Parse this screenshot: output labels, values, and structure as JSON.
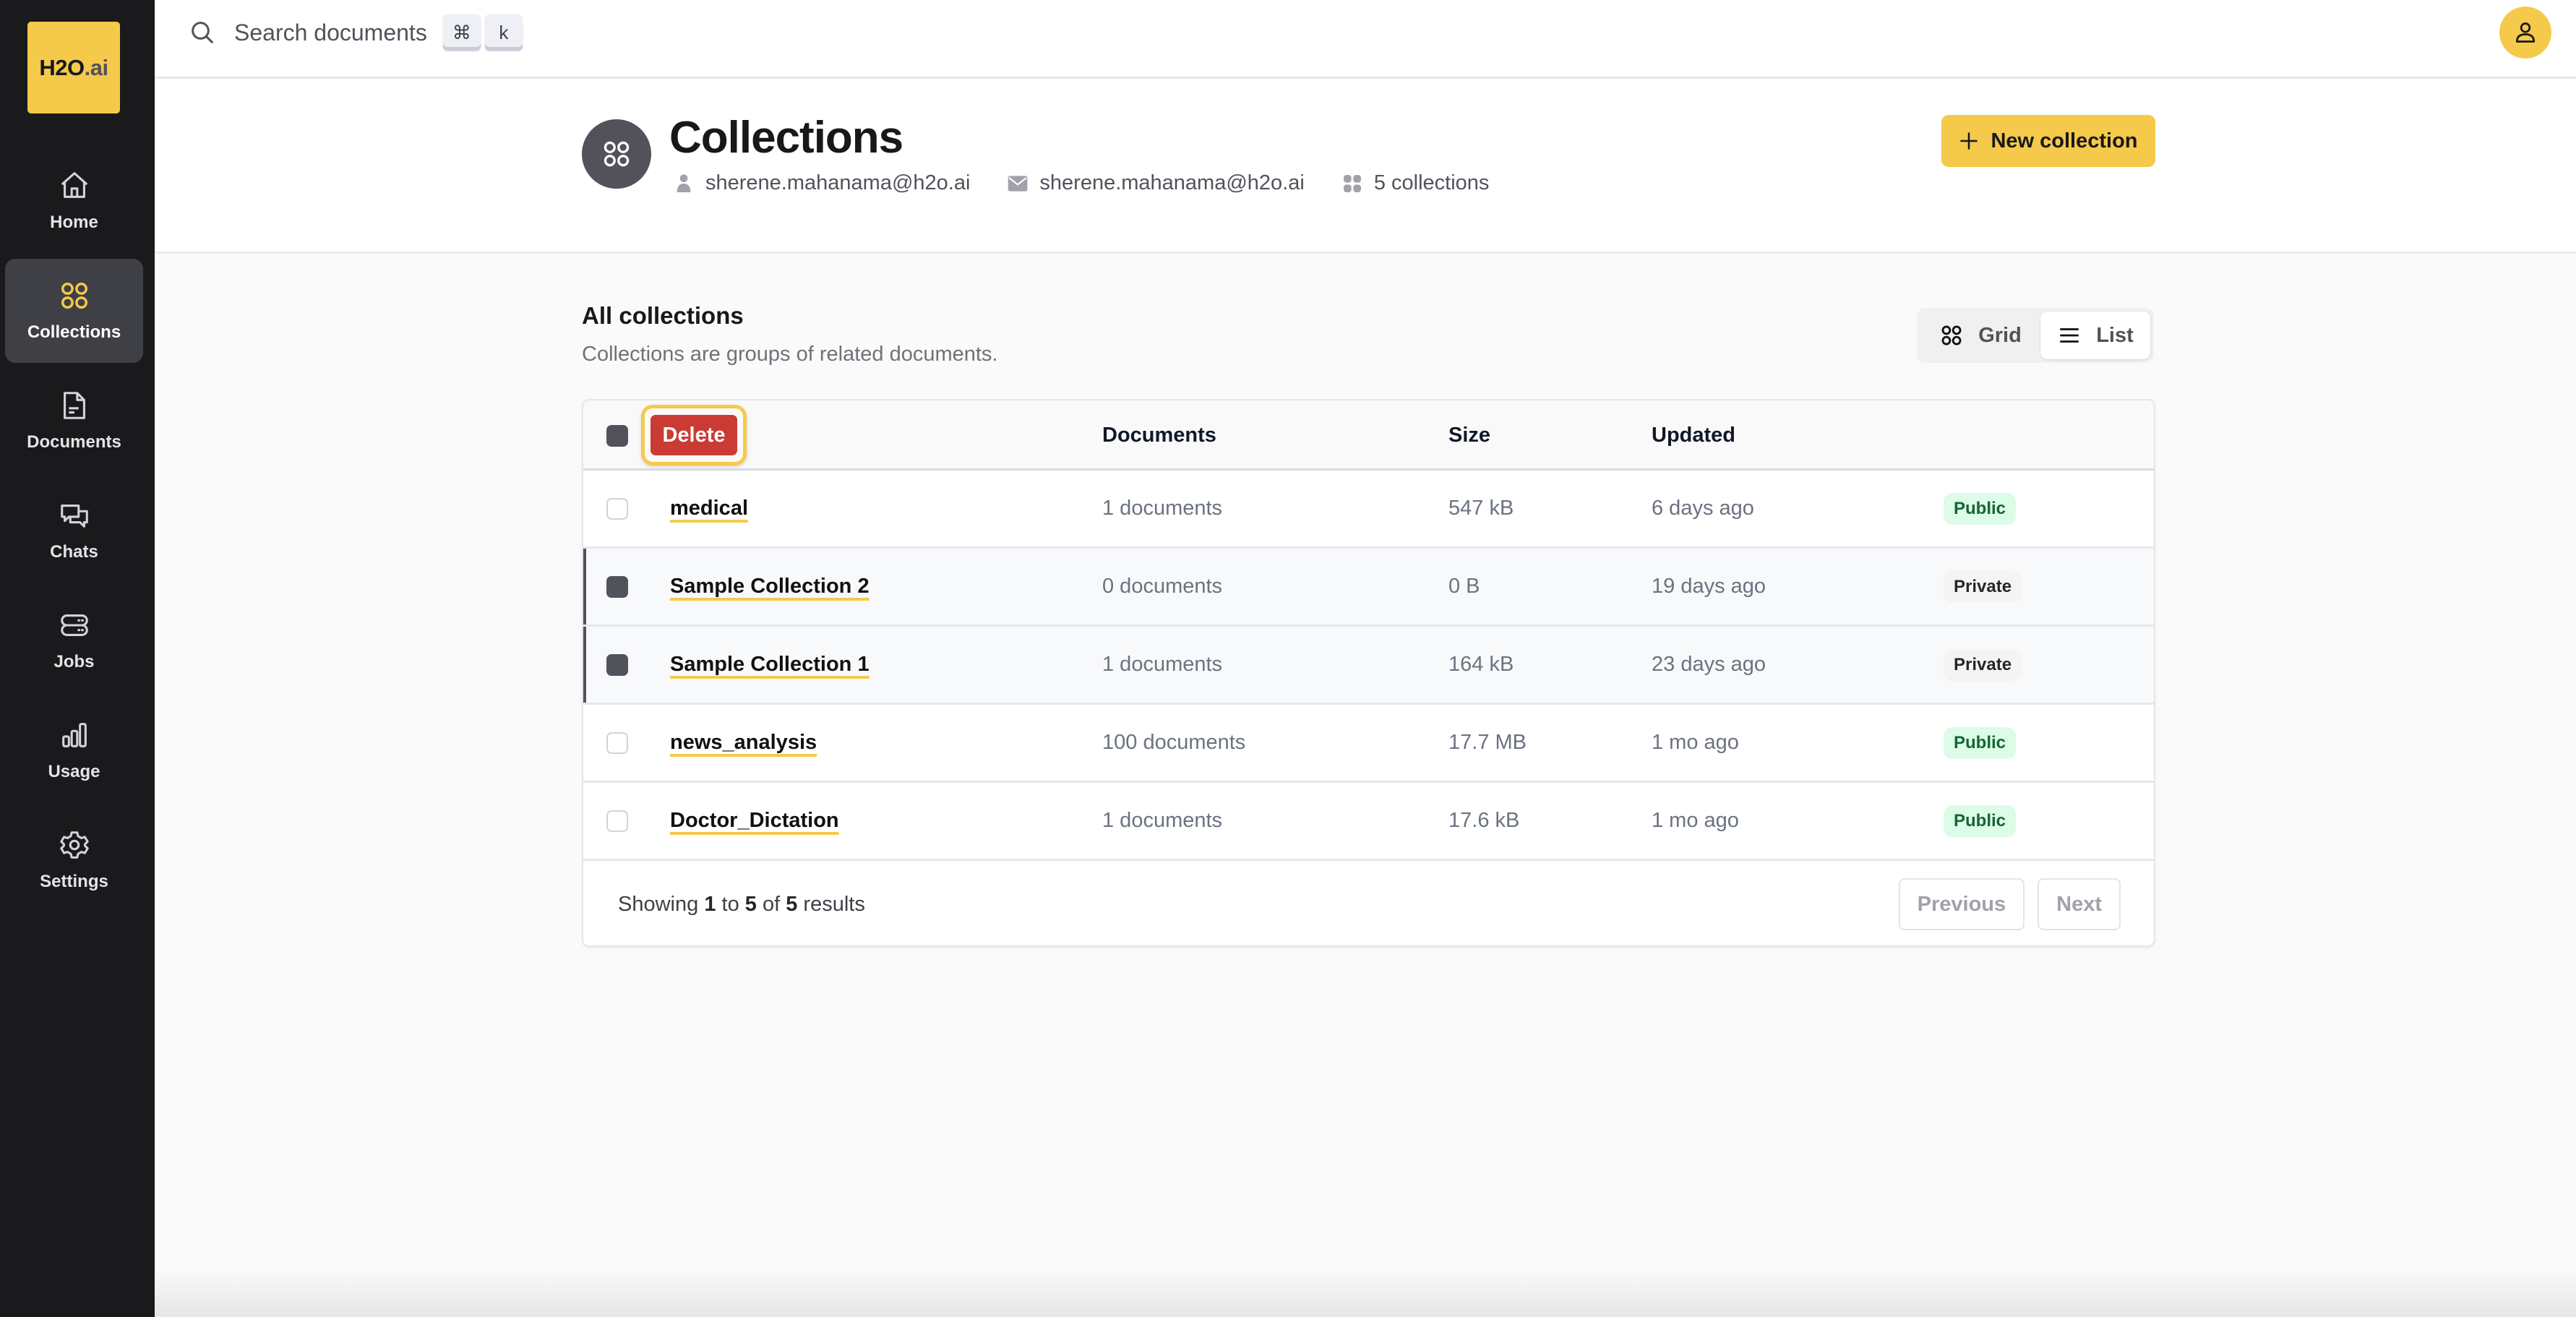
{
  "brand": {
    "logo_main": "H2O",
    "logo_suffix": ".ai",
    "accent": "#f5c94a"
  },
  "sidebar": {
    "items": [
      {
        "label": "Home",
        "icon": "home-icon",
        "active": false
      },
      {
        "label": "Collections",
        "icon": "collections-icon",
        "active": true
      },
      {
        "label": "Documents",
        "icon": "document-icon",
        "active": false
      },
      {
        "label": "Chats",
        "icon": "chats-icon",
        "active": false
      },
      {
        "label": "Jobs",
        "icon": "jobs-icon",
        "active": false
      },
      {
        "label": "Usage",
        "icon": "usage-icon",
        "active": false
      },
      {
        "label": "Settings",
        "icon": "settings-icon",
        "active": false
      }
    ]
  },
  "topbar": {
    "search_placeholder": "Search documents",
    "shortcut_keys": [
      "⌘",
      "k"
    ]
  },
  "page": {
    "title": "Collections",
    "owner": "sherene.mahanama@h2o.ai",
    "email": "sherene.mahanama@h2o.ai",
    "count_label": "5 collections",
    "new_button": "New collection"
  },
  "section": {
    "title": "All collections",
    "subtitle": "Collections are groups of related documents.",
    "view_grid": "Grid",
    "view_list": "List",
    "active_view": "List"
  },
  "table": {
    "delete_label": "Delete",
    "columns": [
      "",
      "Documents",
      "Size",
      "Updated",
      ""
    ],
    "rows": [
      {
        "name": "medical",
        "documents": "1 documents",
        "size": "547 kB",
        "updated": "6 days ago",
        "visibility": "Public",
        "selected": false
      },
      {
        "name": "Sample Collection 2",
        "documents": "0 documents",
        "size": "0 B",
        "updated": "19 days ago",
        "visibility": "Private",
        "selected": true
      },
      {
        "name": "Sample Collection 1",
        "documents": "1 documents",
        "size": "164 kB",
        "updated": "23 days ago",
        "visibility": "Private",
        "selected": true
      },
      {
        "name": "news_analysis",
        "documents": "100 documents",
        "size": "17.7 MB",
        "updated": "1 mo ago",
        "visibility": "Public",
        "selected": false
      },
      {
        "name": "Doctor_Dictation",
        "documents": "1 documents",
        "size": "17.6 kB",
        "updated": "1 mo ago",
        "visibility": "Public",
        "selected": false
      }
    ],
    "footer": {
      "prefix": "Showing",
      "from": "1",
      "to_word": "to",
      "to": "5",
      "of_word": "of",
      "total": "5",
      "suffix": "results",
      "previous": "Previous",
      "next": "Next"
    }
  }
}
